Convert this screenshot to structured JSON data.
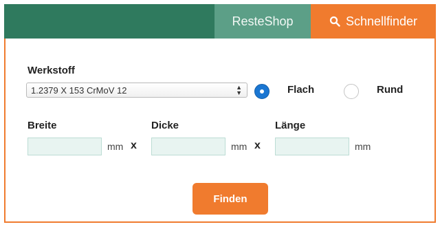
{
  "header": {
    "tabs": [
      {
        "label": "ResteShop"
      },
      {
        "label": "Schnellfinder",
        "icon": "search-icon",
        "active": true
      }
    ],
    "colors": {
      "bar": "#2f7a5e",
      "inactive_tab": "#5c9f87",
      "active_tab": "#f07b2e"
    }
  },
  "form": {
    "material_label": "Werkstoff",
    "material_value": "1.2379 X 153 CrMoV 12",
    "shape_options": [
      {
        "label": "Flach",
        "checked": true
      },
      {
        "label": "Rund",
        "checked": false
      }
    ],
    "fields": [
      {
        "label": "Breite",
        "value": "",
        "unit": "mm"
      },
      {
        "label": "Dicke",
        "value": "",
        "unit": "mm"
      },
      {
        "label": "Länge",
        "value": "",
        "unit": "mm"
      }
    ],
    "separator": "x",
    "submit_label": "Finden"
  }
}
